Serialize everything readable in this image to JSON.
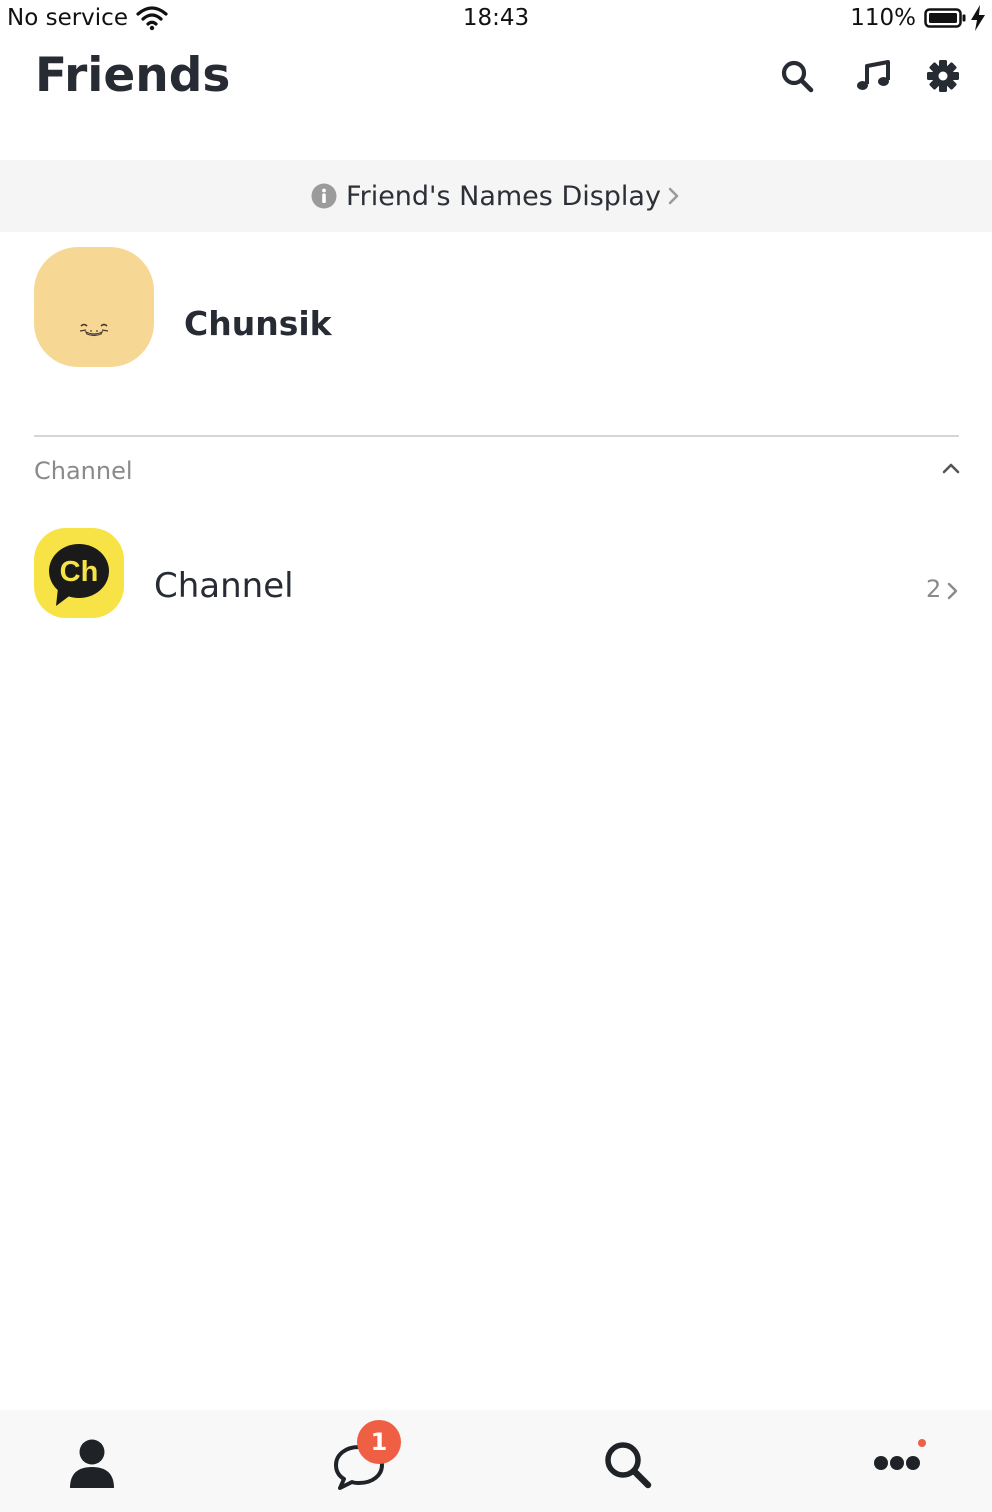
{
  "status_bar": {
    "carrier": "No service",
    "time": "18:43",
    "battery_percent": "110%"
  },
  "header": {
    "title": "Friends",
    "icons": [
      "search-icon",
      "music-note-icon",
      "gear-icon"
    ]
  },
  "banner": {
    "text": "Friend's Names Display"
  },
  "profile": {
    "name": "Chunsik"
  },
  "channel_section": {
    "title": "Channel",
    "item": {
      "name": "Channel",
      "avatar_text": "Ch",
      "count": "2"
    }
  },
  "tab_bar": {
    "tabs": [
      "friends",
      "chats",
      "search",
      "more"
    ],
    "chats_badge": "1"
  },
  "colors": {
    "avatar_bg": "#f6d794",
    "channel_bg": "#f7e345",
    "badge": "#ee5f44",
    "banner_bg": "#f5f5f5",
    "tab_bar_bg": "#f8f8f8"
  }
}
